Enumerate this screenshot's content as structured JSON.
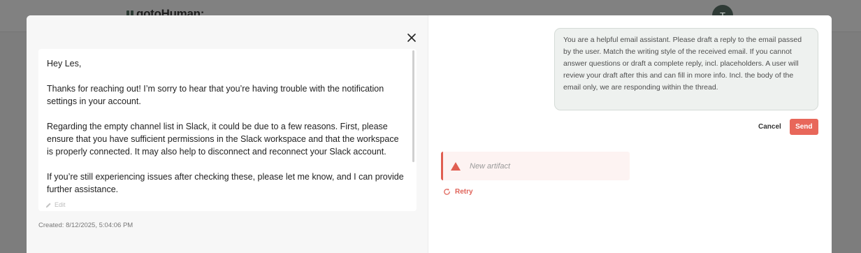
{
  "background": {
    "logo_text": "gotoHuman:",
    "avatar_initial": "T"
  },
  "draft": {
    "paragraphs": [
      "Hey Les,",
      "Thanks for reaching out! I’m sorry to hear that you’re having trouble with the notification settings in your account.",
      "Regarding the empty channel list in Slack, it could be due to a few reasons. First, please ensure that you have sufficient permissions in the Slack workspace and that the workspace is properly connected. It may also help to disconnect and reconnect your Slack account.",
      "If you’re still experiencing issues after checking these, please let me know, and I can provide further assistance."
    ],
    "edit_label": "Edit",
    "created": "Created: 8/12/2025, 5:04:06 PM"
  },
  "chat": {
    "prompt": "You are a helpful email assistant. Please draft a reply to the email passed by the user. Match the writing style of the received email. If you cannot answer questions or draft a complete reply, incl. placeholders. A user will review your draft after this and can fill in more info. Incl. the body of the email only, we are responding within the thread.",
    "cancel_label": "Cancel",
    "send_label": "Send",
    "artifact_label": "New artifact",
    "retry_label": "Retry"
  },
  "colors": {
    "accent": "#e8675a",
    "error": "#e05e51",
    "bubble_bg": "#eef1ef"
  },
  "icons": [
    "logo-icon",
    "close-icon",
    "pencil-icon",
    "warning-triangle-icon",
    "refresh-icon"
  ]
}
